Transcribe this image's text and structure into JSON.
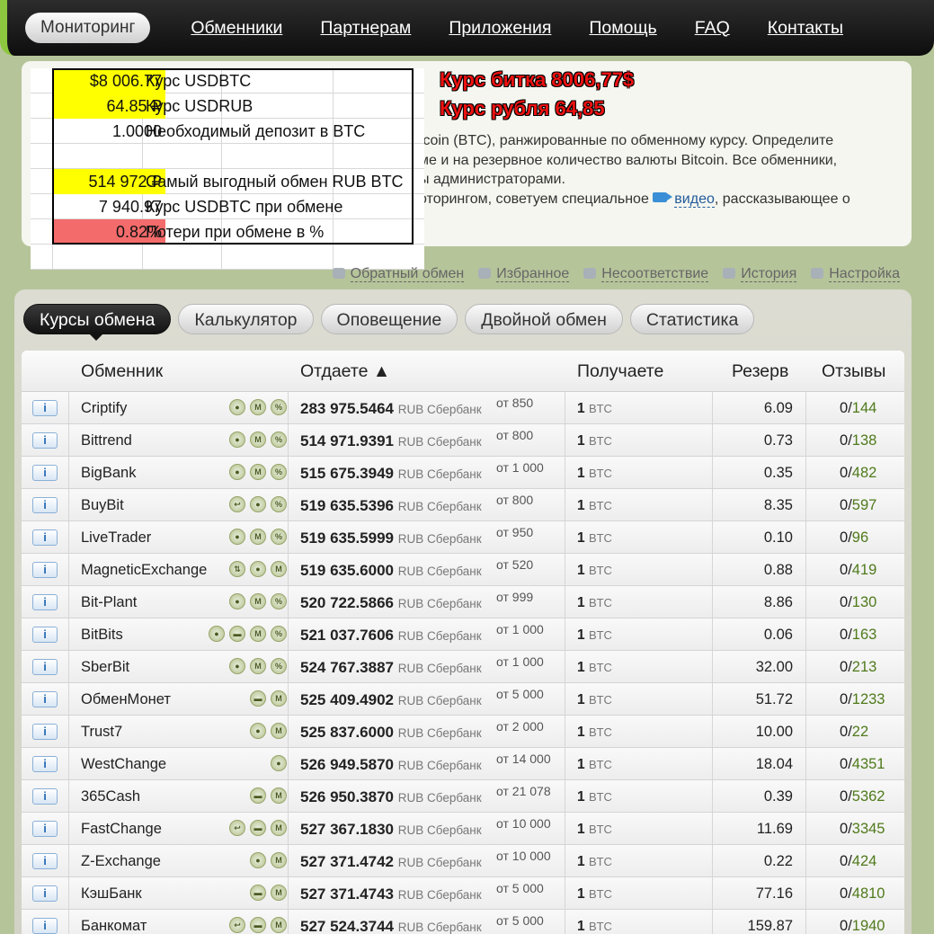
{
  "nav": {
    "active": "Мониторинг",
    "links": [
      "Обменники",
      "Партнерам",
      "Приложения",
      "Помощь",
      "FAQ",
      "Контакты"
    ]
  },
  "headlines": {
    "btc": "Курс битка 8006,77$",
    "rub": "Курс рубля 64,85"
  },
  "description": {
    "line1": "tcoin (BTC), ранжированные по обменному курсу. Определите",
    "line2": "ме и на резервное количество валюты Bitcoin. Все обменники,",
    "line3": "ы администраторами.",
    "line4_pre": "оторингом, советуем специальное",
    "video_link": "видео",
    "line4_post": ", рассказывающее о"
  },
  "sheet": {
    "rows": [
      {
        "value": "$8 006.77",
        "label": "Курс USDBTC",
        "highlight": "#ffff00"
      },
      {
        "value": "64.85 ₽",
        "label": "Курс USDRUB",
        "highlight": "#ffff00"
      },
      {
        "value": "1.0000",
        "label": "Необходимый депозит в BTC",
        "highlight": ""
      },
      {
        "value": "",
        "label": "",
        "highlight": ""
      },
      {
        "value": "514 972 ₽",
        "label": "Самый выгодный обмен RUB BTC",
        "highlight": "#ffff00"
      },
      {
        "value": "7 940.97",
        "label": "Курс USDBTC при обмене",
        "highlight": ""
      },
      {
        "value": "0.82%",
        "label": "Потери при обмене в %",
        "highlight": "#f46b6b"
      }
    ]
  },
  "actions": [
    "Обратный обмен",
    "Избранное",
    "Несоответствие",
    "История",
    "Настройка"
  ],
  "tabs": [
    "Курсы обмена",
    "Калькулятор",
    "Оповещение",
    "Двойной обмен",
    "Статистика"
  ],
  "table": {
    "headers": {
      "exchanger": "Обменник",
      "give": "Отдаете ▲",
      "get": "Получаете",
      "reserve": "Резерв",
      "reviews": "Отзывы"
    },
    "info_label": "i",
    "give_currency": "RUB Сбербанк",
    "get_amount": "1",
    "get_currency": "BTC",
    "rows": [
      {
        "name": "Criptify",
        "badges": [
          "user",
          "M",
          "%"
        ],
        "give": "283 975.5464",
        "min": "от 850",
        "reserve": "6.09",
        "neg": "0",
        "pos": "144"
      },
      {
        "name": "Bittrend",
        "badges": [
          "user",
          "M",
          "%"
        ],
        "give": "514 971.9391",
        "min": "от 800",
        "reserve": "0.73",
        "neg": "0",
        "pos": "138"
      },
      {
        "name": "BigBank",
        "badges": [
          "user",
          "M",
          "%"
        ],
        "give": "515 675.3949",
        "min": "от 1 000",
        "reserve": "0.35",
        "neg": "0",
        "pos": "482"
      },
      {
        "name": "BuyBit",
        "badges": [
          "back",
          "user",
          "%"
        ],
        "give": "519 635.5396",
        "min": "от 800",
        "reserve": "8.35",
        "neg": "0",
        "pos": "597"
      },
      {
        "name": "LiveTrader",
        "badges": [
          "user",
          "M",
          "%"
        ],
        "give": "519 635.5999",
        "min": "от 950",
        "reserve": "0.10",
        "neg": "0",
        "pos": "96"
      },
      {
        "name": "MagneticExchange",
        "badges": [
          "swap",
          "user",
          "M"
        ],
        "give": "519 635.6000",
        "min": "от 520",
        "reserve": "0.88",
        "neg": "0",
        "pos": "419"
      },
      {
        "name": "Bit-Plant",
        "badges": [
          "user",
          "M",
          "%"
        ],
        "give": "520 722.5866",
        "min": "от 999",
        "reserve": "8.86",
        "neg": "0",
        "pos": "130"
      },
      {
        "name": "BitBits",
        "badges": [
          "user",
          "card",
          "M",
          "%"
        ],
        "give": "521 037.7606",
        "min": "от 1 000",
        "reserve": "0.06",
        "neg": "0",
        "pos": "163"
      },
      {
        "name": "SberBit",
        "badges": [
          "user",
          "M",
          "%"
        ],
        "give": "524 767.3887",
        "min": "от 1 000",
        "reserve": "32.00",
        "neg": "0",
        "pos": "213"
      },
      {
        "name": "ОбменМонет",
        "badges": [
          "card",
          "M"
        ],
        "give": "525 409.4902",
        "min": "от 5 000",
        "reserve": "51.72",
        "neg": "0",
        "pos": "1233"
      },
      {
        "name": "Trust7",
        "badges": [
          "user",
          "M"
        ],
        "give": "525 837.6000",
        "min": "от 2 000",
        "reserve": "10.00",
        "neg": "0",
        "pos": "22"
      },
      {
        "name": "WestChange",
        "badges": [
          "user"
        ],
        "give": "526 949.5870",
        "min": "от 14 000",
        "reserve": "18.04",
        "neg": "0",
        "pos": "4351"
      },
      {
        "name": "365Cash",
        "badges": [
          "card",
          "M"
        ],
        "give": "526 950.3870",
        "min": "от 21 078",
        "reserve": "0.39",
        "neg": "0",
        "pos": "5362"
      },
      {
        "name": "FastChange",
        "badges": [
          "back",
          "card",
          "M"
        ],
        "give": "527 367.1830",
        "min": "от 10 000",
        "reserve": "11.69",
        "neg": "0",
        "pos": "3345"
      },
      {
        "name": "Z-Exchange",
        "badges": [
          "user",
          "M"
        ],
        "give": "527 371.4742",
        "min": "от 10 000",
        "reserve": "0.22",
        "neg": "0",
        "pos": "424"
      },
      {
        "name": "КэшБанк",
        "badges": [
          "card",
          "M"
        ],
        "give": "527 371.4743",
        "min": "от 5 000",
        "reserve": "77.16",
        "neg": "0",
        "pos": "4810"
      },
      {
        "name": "Банкомат",
        "badges": [
          "back",
          "card",
          "M"
        ],
        "give": "527 524.3744",
        "min": "от 5 000",
        "reserve": "159.87",
        "neg": "0",
        "pos": "1940"
      }
    ]
  },
  "colors": {
    "accent": "#8dc63f",
    "link_blue": "#225a9c",
    "review_green": "#4f7a1b",
    "headline_red": "#ee1111"
  }
}
